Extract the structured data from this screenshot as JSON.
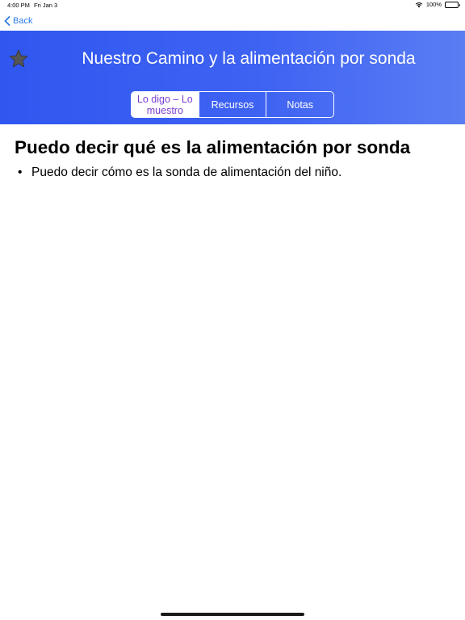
{
  "status_bar": {
    "time": "4:00 PM",
    "date": "Fri Jan 3",
    "battery": "100%"
  },
  "nav": {
    "back_label": "Back"
  },
  "header": {
    "title": "Nuestro Camino y la alimentación por sonda",
    "star_icon": "star-icon",
    "segments": [
      {
        "label": "Lo digo – Lo muestro",
        "selected": true
      },
      {
        "label": "Recursos",
        "selected": false
      },
      {
        "label": "Notas",
        "selected": false
      }
    ]
  },
  "content": {
    "heading": "Puedo decir qué es la alimentación por sonda",
    "bullets": [
      "Puedo decir cómo es la sonda de alimentación del niño."
    ]
  },
  "colors": {
    "header_gradient_start": "#2f57f0",
    "header_gradient_end": "#5a7df4",
    "selected_segment_text": "#7b3fd4",
    "back_link": "#2b7be8",
    "star": "#555555"
  }
}
